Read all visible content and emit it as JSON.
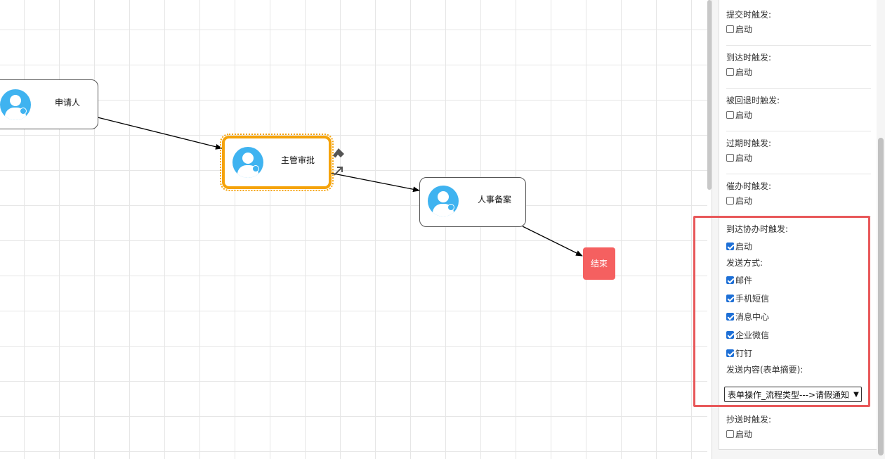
{
  "canvas": {
    "nodes": {
      "applicant": "申请人",
      "manager": "主管审批",
      "hr": "人事备案",
      "end": "结束"
    }
  },
  "panel": {
    "sections": [
      {
        "title": "提交时触发:",
        "enable_label": "启动",
        "checked": false
      },
      {
        "title": "到达时触发:",
        "enable_label": "启动",
        "checked": false
      },
      {
        "title": "被回退时触发:",
        "enable_label": "启动",
        "checked": false
      },
      {
        "title": "过期时触发:",
        "enable_label": "启动",
        "checked": false
      },
      {
        "title": "催办时触发:",
        "enable_label": "启动",
        "checked": false
      }
    ],
    "assist": {
      "title": "到达协办时触发:",
      "enable_label": "启动",
      "enabled": true,
      "send_method_label": "发送方式:",
      "methods": [
        {
          "label": "邮件",
          "checked": true
        },
        {
          "label": "手机短信",
          "checked": true
        },
        {
          "label": "消息中心",
          "checked": true
        },
        {
          "label": "企业微信",
          "checked": true
        },
        {
          "label": "钉钉",
          "checked": true
        }
      ],
      "content_label": "发送内容(表单摘要):",
      "content_value": "表单操作_流程类型--->请假通知"
    },
    "cc": {
      "title": "抄送时触发:",
      "enable_label": "启动",
      "checked": false
    }
  },
  "colors": {
    "highlight": "#e8585a",
    "selected": "#f5a30a",
    "end": "#f56060",
    "avatar": "#3fb3f0"
  }
}
